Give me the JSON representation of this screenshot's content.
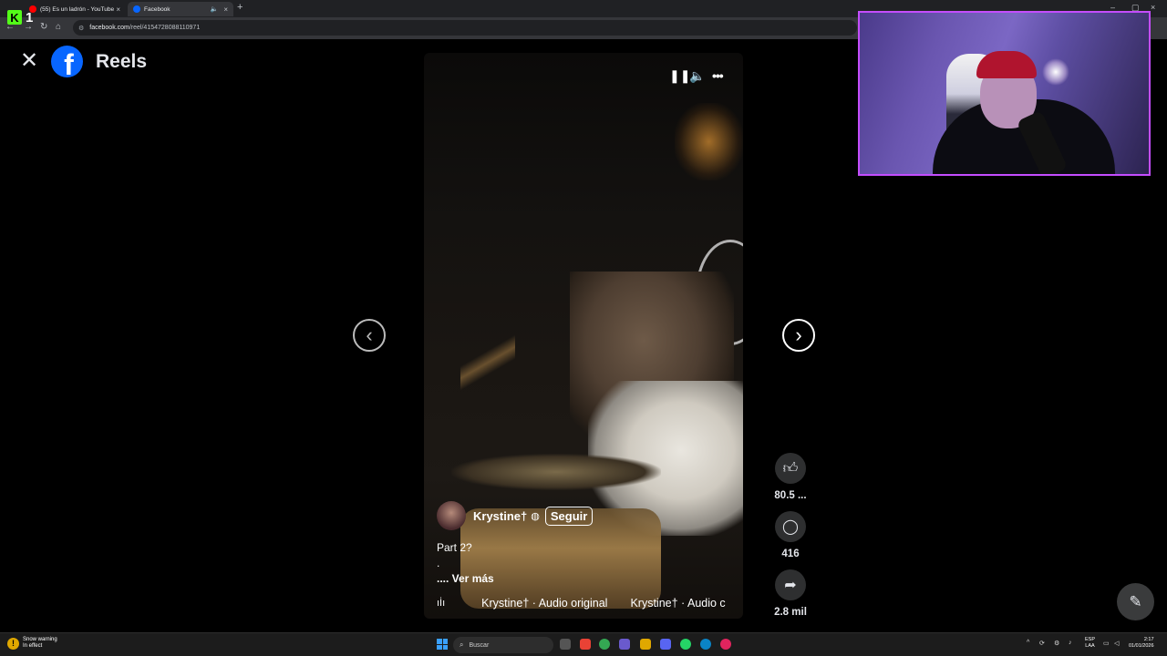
{
  "stream_badge": {
    "logo": "K",
    "count": "1"
  },
  "browser": {
    "tabs": [
      {
        "title": "(55) Es un ladrón - YouTube",
        "favicon_color": "#ff0000",
        "active": false
      },
      {
        "title": "Facebook",
        "favicon_color": "#0866ff",
        "active": true
      }
    ],
    "new_tab_icon": "plus-icon",
    "url_domain": "facebook.com",
    "url_path": "/reel/4154728088110971"
  },
  "header": {
    "close_icon": "close-icon",
    "logo": "f",
    "title": "Reels"
  },
  "video": {
    "controls": {
      "pause": "pause-icon",
      "volume": "volume-icon",
      "more": "more-icon"
    },
    "author": "Krystine†",
    "verified_icon": "globe-icon",
    "follow_label": "Seguir",
    "caption_line1": "Part 2?",
    "caption_line2": ".",
    "caption_more": ".... Ver más",
    "audio_1": "Krystine† · Audio original",
    "audio_2": "Krystine† · Audio c"
  },
  "nav": {
    "prev": "chevron-left-icon",
    "next": "chevron-right-icon"
  },
  "actions": {
    "likes": "80.5 ...",
    "comments": "416",
    "shares": "2.8 mil"
  },
  "taskbar": {
    "weather_line1": "Snow warning",
    "weather_line2": "In effect",
    "search_placeholder": "Buscar",
    "lang_line1": "ESP",
    "lang_line2": "LAA",
    "time": "2:17",
    "date": "01/01/2026"
  }
}
